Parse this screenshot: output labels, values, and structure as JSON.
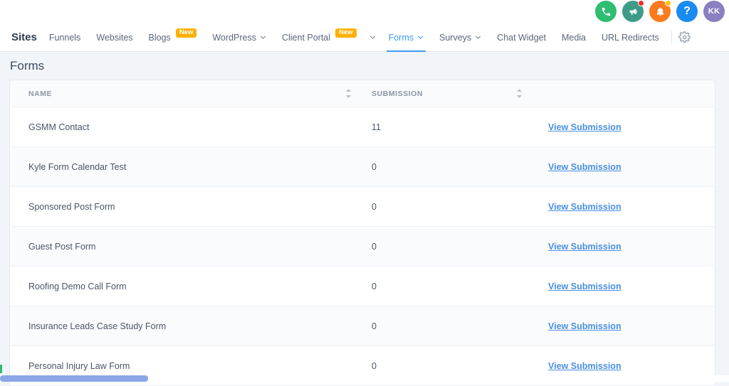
{
  "topbar": {
    "icons": [
      {
        "name": "phone-icon",
        "label": "",
        "badge": "none"
      },
      {
        "name": "megaphone-icon",
        "label": "",
        "badge": "red"
      },
      {
        "name": "bell-icon",
        "label": "",
        "badge": "yellow"
      },
      {
        "name": "help-icon",
        "label": "?",
        "badge": "none"
      },
      {
        "name": "avatar",
        "label": "KK",
        "badge": "none"
      }
    ],
    "avatar_initials": "KK",
    "help_label": "?"
  },
  "nav": {
    "brand": "Sites",
    "items": [
      {
        "label": "Funnels",
        "chevron": false,
        "badge": "",
        "active": false
      },
      {
        "label": "Websites",
        "chevron": false,
        "badge": "",
        "active": false
      },
      {
        "label": "Blogs",
        "chevron": false,
        "badge": "New",
        "active": false
      },
      {
        "label": "WordPress",
        "chevron": true,
        "badge": "",
        "active": false
      },
      {
        "label": "Client Portal",
        "chevron": false,
        "badge": "New",
        "active": false
      },
      {
        "label": "",
        "chevron": true,
        "badge": "",
        "active": false
      },
      {
        "label": "Forms",
        "chevron": true,
        "badge": "",
        "active": true
      },
      {
        "label": "Surveys",
        "chevron": true,
        "badge": "",
        "active": false
      },
      {
        "label": "Chat Widget",
        "chevron": false,
        "badge": "",
        "active": false
      },
      {
        "label": "Media",
        "chevron": false,
        "badge": "",
        "active": false
      },
      {
        "label": "URL Redirects",
        "chevron": false,
        "badge": "",
        "active": false
      }
    ],
    "settings_icon": "gear-icon"
  },
  "page": {
    "title": "Forms"
  },
  "table": {
    "columns": [
      "NAME",
      "SUBMISSION",
      ""
    ],
    "header_name": "NAME",
    "header_submission": "SUBMISSION",
    "action_label": "View Submission",
    "rows": [
      {
        "name": "GSMM Contact",
        "submission": "11",
        "action": "View Submission"
      },
      {
        "name": "Kyle Form Calendar Test",
        "submission": "0",
        "action": "View Submission"
      },
      {
        "name": "Sponsored Post Form",
        "submission": "0",
        "action": "View Submission"
      },
      {
        "name": "Guest Post Form",
        "submission": "0",
        "action": "View Submission"
      },
      {
        "name": "Roofing Demo Call Form",
        "submission": "0",
        "action": "View Submission"
      },
      {
        "name": "Insurance Leads Case Study Form",
        "submission": "0",
        "action": "View Submission"
      },
      {
        "name": "Personal Injury Law Form",
        "submission": "0",
        "action": "View Submission"
      }
    ]
  },
  "colors": {
    "accent_blue": "#3f9bf0",
    "link_blue": "#4a90e2",
    "badge_new": "#ffb000",
    "page_bg": "#f1f5f9",
    "scrollbar": "#8ba7e8",
    "phone_green": "#2ebd71",
    "megaphone_teal": "#3d9b87",
    "bell_orange": "#fb7b1e",
    "help_blue": "#1a8bf0",
    "avatar_purple": "#8a7fc0"
  }
}
